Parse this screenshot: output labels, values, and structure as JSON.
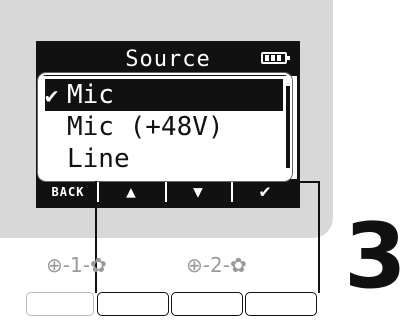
{
  "screen": {
    "title": "Source",
    "battery_icon": "battery-full-icon",
    "items": [
      {
        "label": "Mic",
        "selected": true,
        "check": "✔"
      },
      {
        "label": "Mic (+48V)",
        "selected": false,
        "check": ""
      },
      {
        "label": "Line",
        "selected": false,
        "check": ""
      }
    ],
    "softkeys": [
      {
        "label": "BACK",
        "icon": "back-text"
      },
      {
        "label": "▲",
        "icon": "up-arrow-icon"
      },
      {
        "label": "▼",
        "icon": "down-arrow-icon"
      },
      {
        "label": "✔",
        "icon": "check-icon"
      }
    ]
  },
  "controls": {
    "knob1": {
      "label": "-1-"
    },
    "knob2": {
      "label": "-2-"
    }
  },
  "step_number": "3",
  "colors": {
    "lcd_bg": "#ffffff",
    "lcd_fg": "#111111",
    "device_bg": "#d8d8d8",
    "dim": "#9a9a9a"
  }
}
